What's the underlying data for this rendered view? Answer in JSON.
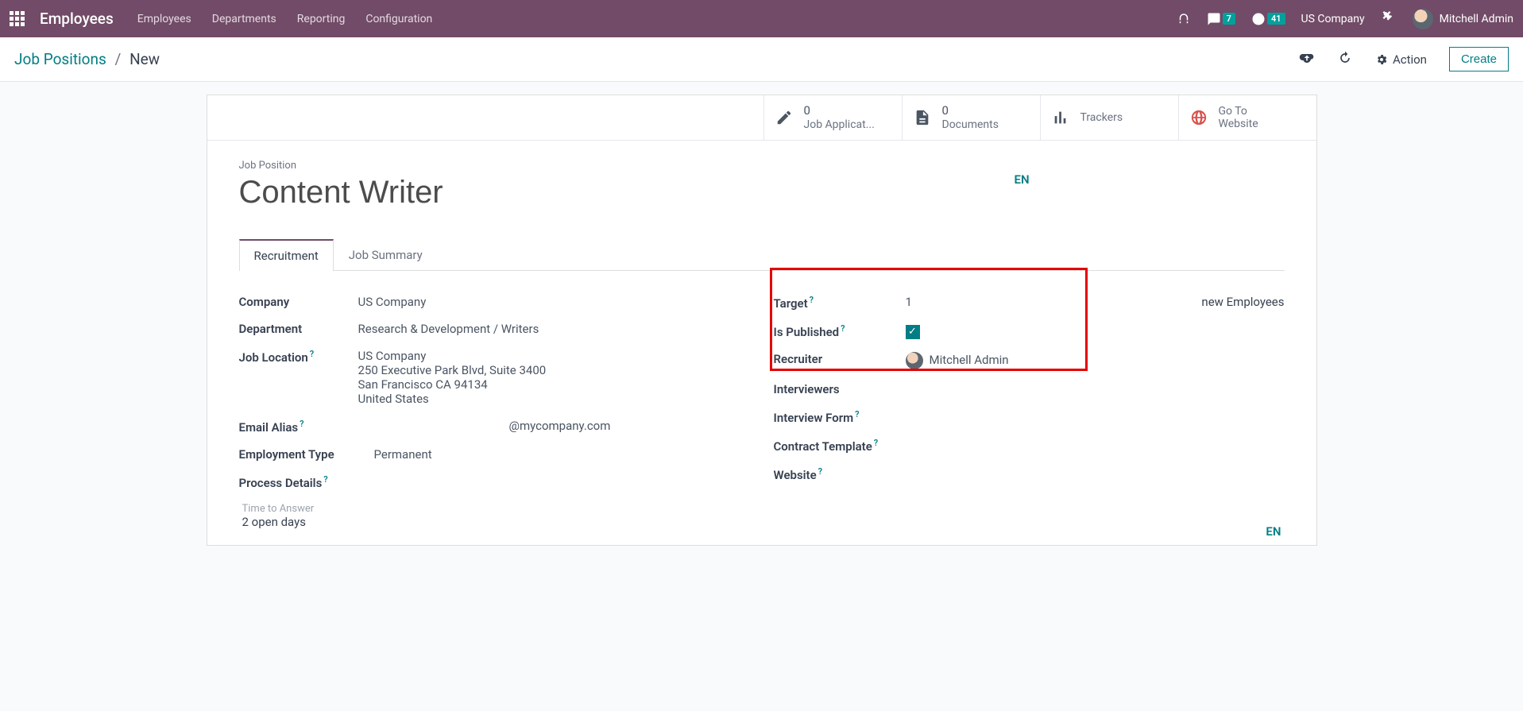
{
  "nav": {
    "brand": "Employees",
    "menu": [
      "Employees",
      "Departments",
      "Reporting",
      "Configuration"
    ],
    "messages_badge": "7",
    "activities_badge": "41",
    "company": "US Company",
    "user": "Mitchell Admin"
  },
  "breadcrumb": {
    "parent": "Job Positions",
    "current": "New"
  },
  "controlbar": {
    "action_label": "Action",
    "create_label": "Create"
  },
  "stat_buttons": {
    "applications": {
      "count": "0",
      "label": "Job Applicat..."
    },
    "documents": {
      "count": "0",
      "label": "Documents"
    },
    "trackers": {
      "label": "Trackers"
    },
    "website": {
      "line1": "Go To",
      "line2": "Website"
    }
  },
  "form": {
    "title_label": "Job Position",
    "title_value": "Content Writer",
    "lang": "EN",
    "tabs": {
      "recruitment": "Recruitment",
      "summary": "Job Summary"
    },
    "left": {
      "company_label": "Company",
      "company_value": "US Company",
      "department_label": "Department",
      "department_value": "Research & Development / Writers",
      "location_label": "Job Location",
      "location_line1": "US Company",
      "location_line2": "250 Executive Park Blvd, Suite 3400",
      "location_line3": "San Francisco CA 94134",
      "location_line4": "United States",
      "email_alias_label": "Email Alias",
      "email_alias_suffix": "@mycompany.com",
      "employment_type_label": "Employment Type",
      "employment_type_value": "Permanent",
      "process_details_label": "Process Details",
      "time_to_answer_label": "Time to Answer",
      "time_to_answer_value": "2 open days"
    },
    "right": {
      "target_label": "Target",
      "target_value": "1",
      "target_suffix": "new Employees",
      "published_label": "Is Published",
      "recruiter_label": "Recruiter",
      "recruiter_value": "Mitchell Admin",
      "interviewers_label": "Interviewers",
      "interview_form_label": "Interview Form",
      "contract_template_label": "Contract Template",
      "website_label": "Website"
    }
  }
}
